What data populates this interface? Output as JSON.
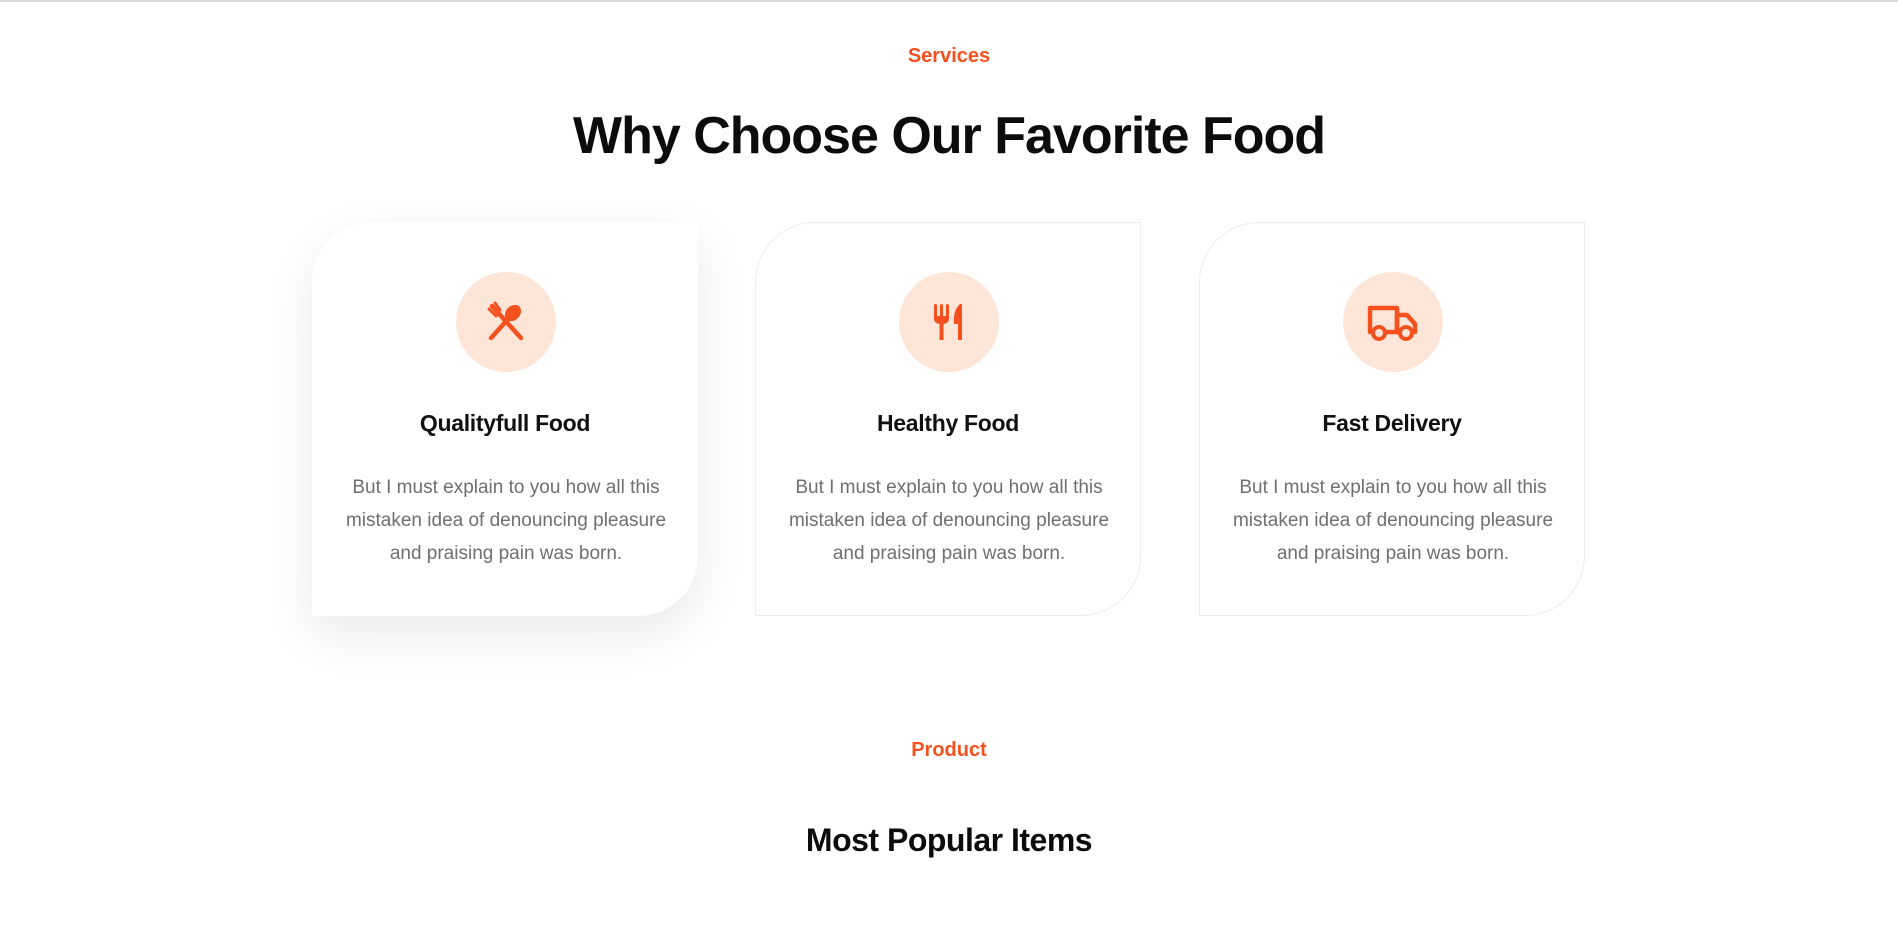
{
  "services": {
    "tag": "Services",
    "title": "Why Choose Our Favorite Food"
  },
  "cards": [
    {
      "icon": "cutlery-cross-icon",
      "title": "Qualityfull Food",
      "text": "But I must explain to you how all this mistaken idea of denouncing pleasure and praising pain was born."
    },
    {
      "icon": "fork-knife-icon",
      "title": "Healthy Food",
      "text": "But I must explain to you how all this mistaken idea of denouncing pleasure and praising pain was born."
    },
    {
      "icon": "delivery-truck-icon",
      "title": "Fast Delivery",
      "text": "But I must explain to you how all this mistaken idea of denouncing pleasure and praising pain was born."
    }
  ],
  "product": {
    "tag": "Product",
    "title": "Most Popular Items"
  },
  "colors": {
    "accent": "#f4511e",
    "icon_bg": "#fde5d8",
    "heading": "#0c0c0c",
    "body_text": "#6f6f6f"
  }
}
